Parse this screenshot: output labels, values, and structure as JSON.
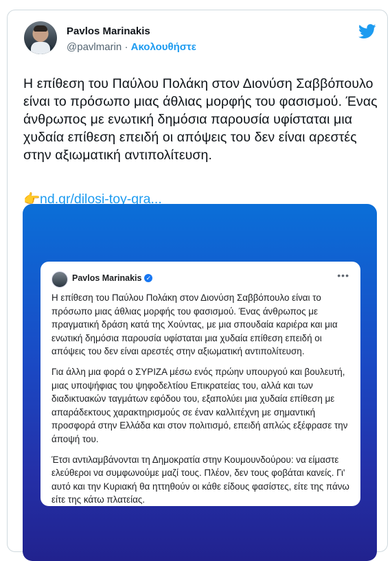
{
  "author": {
    "name": "Pavlos Marinakis",
    "handle": "@pavlmarin",
    "separator": "·",
    "follow_label": "Ακολουθήστε"
  },
  "tweet": {
    "text": "Η επίθεση του Παύλου Πολάκη στον Διονύση Σαββόπουλο είναι το πρόσωπο μιας άθλιας μορφής του φασισμού. Ένας άνθρωπος με ενωτική δημόσια παρουσία υφίσταται μια χυδαία επίθεση επειδή οι απόψεις του δεν είναι αρεστές στην αξιωματική αντιπολίτευση.",
    "link_emoji": "👉",
    "link_text": "nd.gr/dilosi-toy-gra..."
  },
  "embedded_post": {
    "name": "Pavlos Marinakis",
    "verified_glyph": "✓",
    "more_glyph": "•••",
    "paragraphs": [
      "Η επίθεση του Παύλου Πολάκη στον Διονύση Σαββόπουλο είναι το πρόσωπο μιας άθλιας μορφής του φασισμού. Ένας άνθρωπος με πραγματική δράση κατά της Χούντας, με μια σπουδαία καριέρα και μια ενωτική δημόσια παρουσία υφίσταται μια χυδαία επίθεση επειδή οι απόψεις του δεν είναι αρεστές στην αξιωματική αντιπολίτευση.",
      "Για άλλη μια φορά ο ΣΥΡΙΖΑ μέσω ενός πρώην υπουργού και βουλευτή, μιας υποψήφιας του ψηφοδελτίου Επικρατείας του, αλλά και των διαδικτυακών ταγμάτων εφόδου του, εξαπολύει μια χυδαία επίθεση με απαράδεκτους χαρακτηρισμούς σε έναν καλλιτέχνη με σημαντική προσφορά στην Ελλάδα και στον πολιτισμό, επειδή απλώς εξέφρασε την άποψή του.",
      "Έτσι αντιλαμβάνονται τη Δημοκρατία στην Κουμουνδούρου: να είμαστε ελεύθεροι να συμφωνούμε μαζί τους. Πλέον, δεν τους φοβάται κανείς. Γι' αυτό και την Κυριακή θα ηττηθούν οι κάθε είδους φασίστες, είτε της πάνω είτε της κάτω πλατείας."
    ]
  },
  "colors": {
    "accent": "#1d9bf0",
    "media_gradient_top": "#0b6fd8",
    "media_gradient_bottom": "#21228e"
  }
}
